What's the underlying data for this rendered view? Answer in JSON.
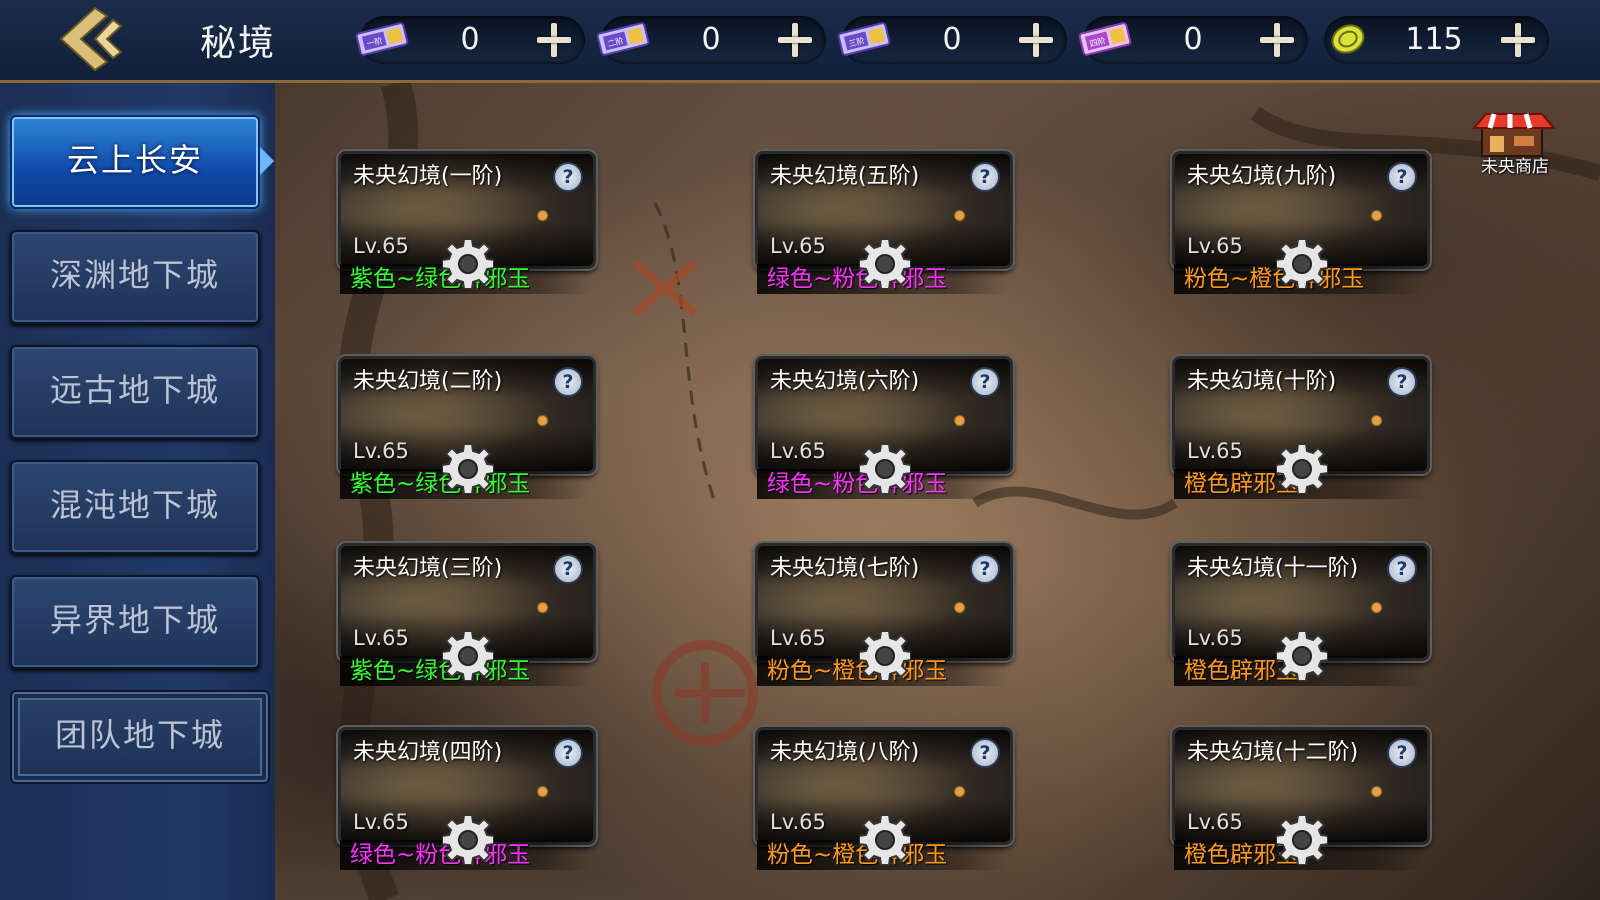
{
  "header": {
    "title": "秘境",
    "resources": [
      {
        "icon": "ticket-1-icon",
        "ticket_text": "一阶",
        "value": "0"
      },
      {
        "icon": "ticket-2-icon",
        "ticket_text": "二阶",
        "value": "0"
      },
      {
        "icon": "ticket-3-icon",
        "ticket_text": "三阶",
        "value": "0"
      },
      {
        "icon": "ticket-4-icon",
        "ticket_text": "四阶",
        "value": "0"
      },
      {
        "icon": "coin-icon",
        "value": "115"
      }
    ]
  },
  "sidebar": {
    "items": [
      {
        "label": "云上长安",
        "active": true
      },
      {
        "label": "深渊地下城",
        "active": false
      },
      {
        "label": "远古地下城",
        "active": false
      },
      {
        "label": "混沌地下城",
        "active": false
      },
      {
        "label": "异界地下城",
        "active": false
      },
      {
        "label": "团队地下城",
        "active": false
      }
    ]
  },
  "shop": {
    "label": "未央商店",
    "icon": "shop-stall-icon"
  },
  "dungeons": [
    {
      "title": "未央幻境(一阶)",
      "level": "Lv.65",
      "reward": "紫色~绿色辟邪玉",
      "reward_color": "#33ff33"
    },
    {
      "title": "未央幻境(二阶)",
      "level": "Lv.65",
      "reward": "紫色~绿色辟邪玉",
      "reward_color": "#33ff33"
    },
    {
      "title": "未央幻境(三阶)",
      "level": "Lv.65",
      "reward": "紫色~绿色辟邪玉",
      "reward_color": "#33ff33"
    },
    {
      "title": "未央幻境(四阶)",
      "level": "Lv.65",
      "reward": "绿色~粉色辟邪玉",
      "reward_color": "#ff33ff"
    },
    {
      "title": "未央幻境(五阶)",
      "level": "Lv.65",
      "reward": "绿色~粉色辟邪玉",
      "reward_color": "#ff33ff"
    },
    {
      "title": "未央幻境(六阶)",
      "level": "Lv.65",
      "reward": "绿色~粉色辟邪玉",
      "reward_color": "#ff33ff"
    },
    {
      "title": "未央幻境(七阶)",
      "level": "Lv.65",
      "reward": "粉色~橙色辟邪玉",
      "reward_color": "#ff9a1a"
    },
    {
      "title": "未央幻境(八阶)",
      "level": "Lv.65",
      "reward": "粉色~橙色辟邪玉",
      "reward_color": "#ff9a1a"
    },
    {
      "title": "未央幻境(九阶)",
      "level": "Lv.65",
      "reward": "粉色~橙色辟邪玉",
      "reward_color": "#ff9a1a"
    },
    {
      "title": "未央幻境(十阶)",
      "level": "Lv.65",
      "reward": "橙色辟邪玉",
      "reward_color": "#ff9a1a"
    },
    {
      "title": "未央幻境(十一阶)",
      "level": "Lv.65",
      "reward": "橙色辟邪玉",
      "reward_color": "#ff9a1a"
    },
    {
      "title": "未央幻境(十二阶)",
      "level": "Lv.65",
      "reward": "橙色辟邪玉",
      "reward_color": "#ff9a1a"
    }
  ],
  "icons": {
    "back": "back-arrow-icon",
    "help": "question-icon",
    "settings": "gear-icon",
    "plus": "plus-icon"
  }
}
